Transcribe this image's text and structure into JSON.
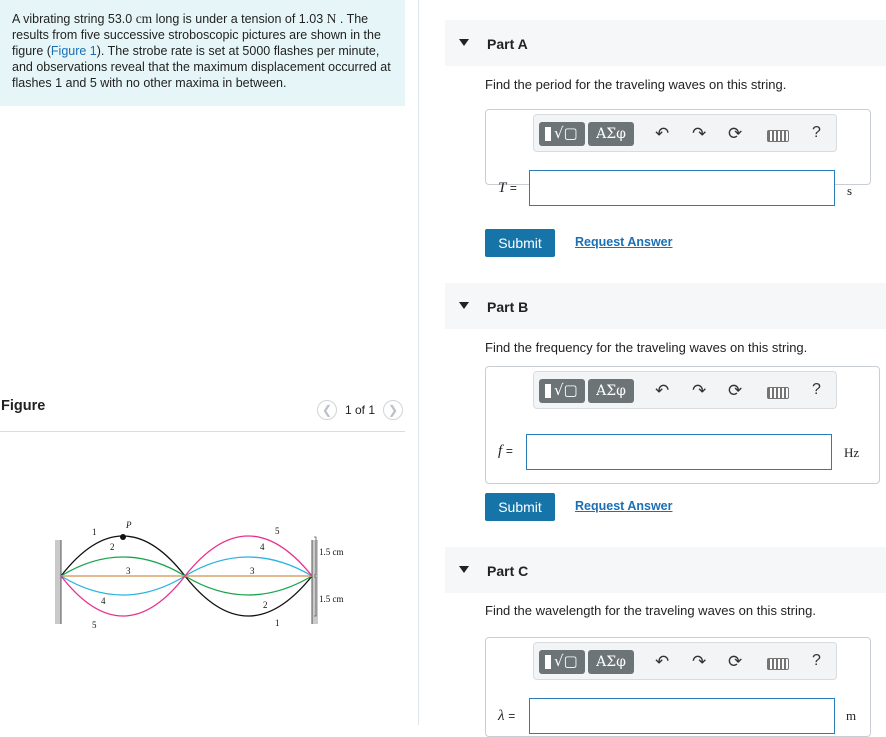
{
  "problem": {
    "text_1": "A vibrating string 53.0 ",
    "unit_cm": "cm",
    "text_2": " long is under a tension of 1.03 ",
    "unit_N": "N",
    "text_3": " . The results from five successive stroboscopic pictures are shown in the figure (",
    "figure_link": "Figure 1",
    "text_4": "). The strobe rate is set at 5000 flashes per minute, and observations reveal that the maximum displacement occurred at flashes 1 and 5 with no other maxima in between."
  },
  "figure": {
    "title": "Figure",
    "pager": "1 of 1",
    "prev_icon": "chevron-left-icon",
    "next_icon": "chevron-right-icon",
    "labels": {
      "p": "P",
      "n1": "1",
      "n2": "2",
      "n3": "3",
      "n4": "4",
      "n5": "5",
      "scale_top": "1.5 cm",
      "scale_bottom": "1.5 cm"
    },
    "colors": {
      "flash1": "#111111",
      "flash2": "#1aa34a",
      "flash3": "#d9a36b",
      "flash4": "#2bb3e0",
      "flash5": "#e8318b"
    }
  },
  "parts": [
    {
      "title": "Part A",
      "question": "Find the period for the traveling waves on this string.",
      "variable": "T",
      "equals": "=",
      "unit": "s",
      "submit": "Submit",
      "request": "Request Answer"
    },
    {
      "title": "Part B",
      "question": "Find the frequency for the traveling waves on this string.",
      "variable": "f",
      "equals": "=",
      "unit": "Hz",
      "submit": "Submit",
      "request": "Request Answer"
    },
    {
      "title": "Part C",
      "question": "Find the wavelength for the traveling waves on this string.",
      "variable": "λ",
      "equals": "=",
      "unit": "m"
    }
  ],
  "toolbar": {
    "greek": "ΑΣφ",
    "undo": "↶",
    "redo": "↷",
    "reset": "⟳",
    "help": "?"
  }
}
